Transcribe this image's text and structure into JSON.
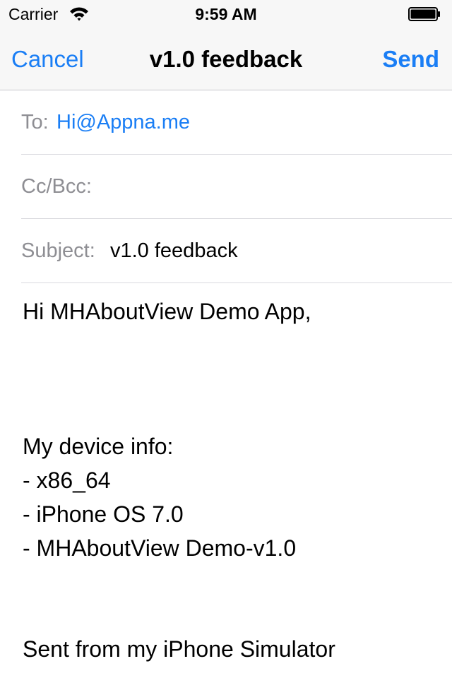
{
  "status_bar": {
    "carrier": "Carrier",
    "time": "9:59 AM",
    "icons": [
      "wifi-icon",
      "battery-icon"
    ]
  },
  "nav": {
    "cancel": "Cancel",
    "title": "v1.0 feedback",
    "send": "Send"
  },
  "fields": {
    "to_label": "To:",
    "to_value": "Hi@Appna.me",
    "cc_label": "Cc/Bcc:",
    "cc_value": "",
    "subject_label": "Subject:",
    "subject_value": "v1.0 feedback"
  },
  "body": {
    "greeting": "Hi MHAboutView Demo App,",
    "device_header": "My device info:",
    "device_lines": [
      "- x86_64",
      "- iPhone OS 7.0",
      "- MHAboutView Demo-v1.0"
    ],
    "signature": "Sent from my iPhone Simulator"
  },
  "colors": {
    "accent": "#1a7ef5",
    "label_gray": "#8e8e93",
    "separator": "#d9d9de",
    "bar_background": "#f7f7f7"
  }
}
